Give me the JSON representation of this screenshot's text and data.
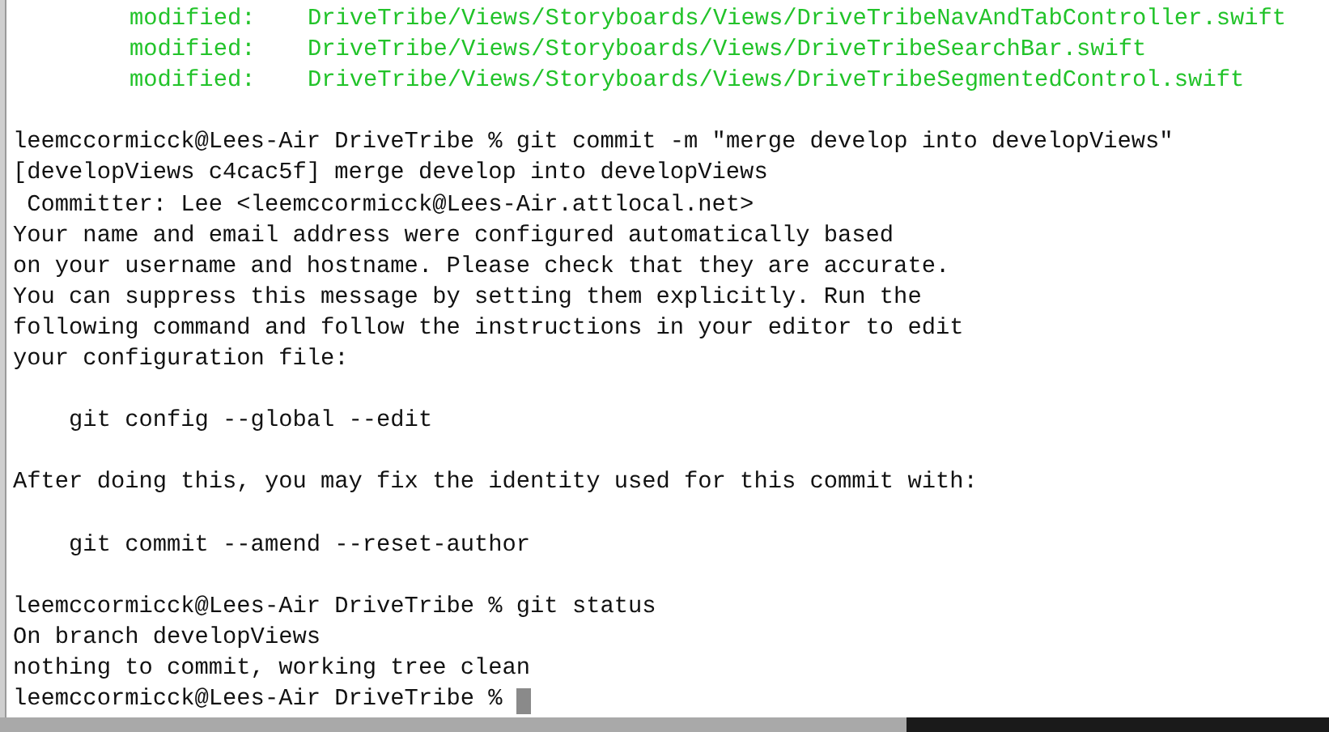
{
  "terminal": {
    "lines": [
      {
        "kind": "modified",
        "label": "modified:",
        "path": "DriveTribe/Views/Storyboards/Views/DriveTribeNavAndTabController.swift"
      },
      {
        "kind": "modified",
        "label": "modified:",
        "path": "DriveTribe/Views/Storyboards/Views/DriveTribeSearchBar.swift"
      },
      {
        "kind": "modified",
        "label": "modified:",
        "path": "DriveTribe/Views/Storyboards/Views/DriveTribeSegmentedControl.swift"
      },
      {
        "kind": "blank"
      },
      {
        "kind": "prompt",
        "prompt": "leemccormicck@Lees-Air DriveTribe %",
        "command": "git commit -m \"merge develop into developViews\"",
        "cursor": false
      },
      {
        "kind": "output",
        "text": "[developViews c4cac5f] merge develop into developViews"
      },
      {
        "kind": "output",
        "text": " Committer: Lee <leemccormicck@Lees-Air.attlocal.net>"
      },
      {
        "kind": "output",
        "text": "Your name and email address were configured automatically based"
      },
      {
        "kind": "output",
        "text": "on your username and hostname. Please check that they are accurate."
      },
      {
        "kind": "output",
        "text": "You can suppress this message by setting them explicitly. Run the"
      },
      {
        "kind": "output",
        "text": "following command and follow the instructions in your editor to edit"
      },
      {
        "kind": "output",
        "text": "your configuration file:"
      },
      {
        "kind": "blank"
      },
      {
        "kind": "output",
        "text": "    git config --global --edit"
      },
      {
        "kind": "blank"
      },
      {
        "kind": "output",
        "text": "After doing this, you may fix the identity used for this commit with:"
      },
      {
        "kind": "blank"
      },
      {
        "kind": "output",
        "text": "    git commit --amend --reset-author"
      },
      {
        "kind": "blank"
      },
      {
        "kind": "prompt",
        "prompt": "leemccormicck@Lees-Air DriveTribe %",
        "command": "git status",
        "cursor": false
      },
      {
        "kind": "output",
        "text": "On branch developViews"
      },
      {
        "kind": "output",
        "text": "nothing to commit, working tree clean"
      },
      {
        "kind": "prompt",
        "prompt": "leemccormicck@Lees-Air DriveTribe %",
        "cursor": true
      }
    ]
  }
}
